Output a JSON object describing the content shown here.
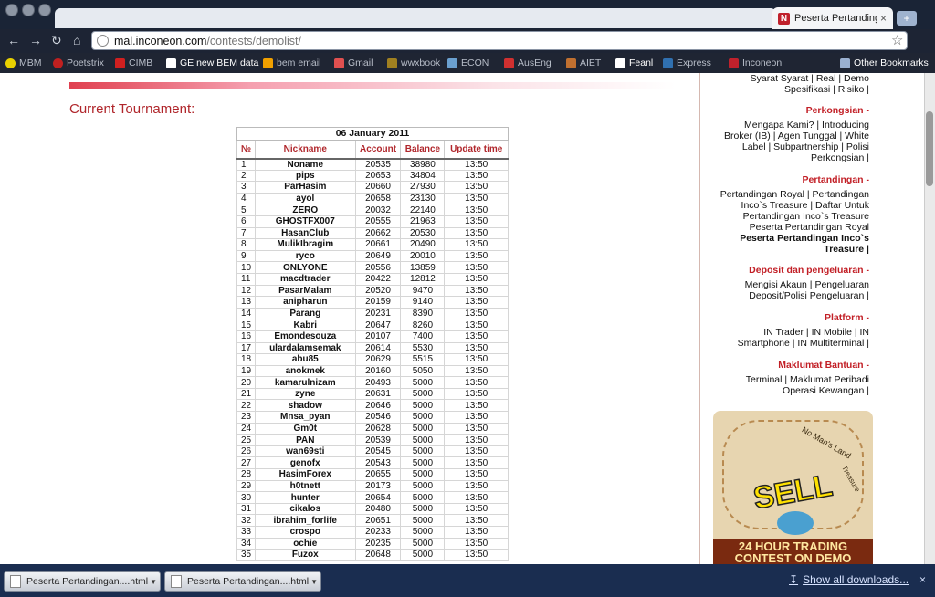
{
  "browser": {
    "tab_title": "Peserta Pertandingan",
    "tab_close": "×",
    "url_host": "mal.inconeon.com",
    "url_path": "/contests/demolist/",
    "bookmarks": [
      "MBM",
      "Poetstrix",
      "CIMB",
      "GE new BEM data",
      "bem email",
      "Gmail",
      "wwxbook",
      "ECON",
      "AusEng",
      "AIET",
      "Feanl",
      "Express",
      "Inconeon"
    ],
    "other_bookmarks": "Other Bookmarks"
  },
  "main": {
    "section_title": "Current Tournament:",
    "table": {
      "date": "06 January 2011",
      "columns": [
        "№",
        "Nickname",
        "Account",
        "Balance",
        "Update time"
      ],
      "rows": [
        [
          "1",
          "Noname",
          "20535",
          "38980",
          "13:50"
        ],
        [
          "2",
          "pips",
          "20653",
          "34804",
          "13:50"
        ],
        [
          "3",
          "ParHasim",
          "20660",
          "27930",
          "13:50"
        ],
        [
          "4",
          "ayol",
          "20658",
          "23130",
          "13:50"
        ],
        [
          "5",
          "ZERO",
          "20032",
          "22140",
          "13:50"
        ],
        [
          "6",
          "GHOSTFX007",
          "20555",
          "21963",
          "13:50"
        ],
        [
          "7",
          "HasanClub",
          "20662",
          "20530",
          "13:50"
        ],
        [
          "8",
          "MulikIbragim",
          "20661",
          "20490",
          "13:50"
        ],
        [
          "9",
          "ryco",
          "20649",
          "20010",
          "13:50"
        ],
        [
          "10",
          "ONLYONE",
          "20556",
          "13859",
          "13:50"
        ],
        [
          "11",
          "macdtrader",
          "20422",
          "12812",
          "13:50"
        ],
        [
          "12",
          "PasarMalam",
          "20520",
          "9470",
          "13:50"
        ],
        [
          "13",
          "anipharun",
          "20159",
          "9140",
          "13:50"
        ],
        [
          "14",
          "Parang",
          "20231",
          "8390",
          "13:50"
        ],
        [
          "15",
          "Kabri",
          "20647",
          "8260",
          "13:50"
        ],
        [
          "16",
          "Emondesouza",
          "20107",
          "7400",
          "13:50"
        ],
        [
          "17",
          "ulardalamsemak",
          "20614",
          "5530",
          "13:50"
        ],
        [
          "18",
          "abu85",
          "20629",
          "5515",
          "13:50"
        ],
        [
          "19",
          "anokmek",
          "20160",
          "5050",
          "13:50"
        ],
        [
          "20",
          "kamarulnizam",
          "20493",
          "5000",
          "13:50"
        ],
        [
          "21",
          "zyne",
          "20631",
          "5000",
          "13:50"
        ],
        [
          "22",
          "shadow",
          "20646",
          "5000",
          "13:50"
        ],
        [
          "23",
          "Mnsa_pyan",
          "20546",
          "5000",
          "13:50"
        ],
        [
          "24",
          "Gm0t",
          "20628",
          "5000",
          "13:50"
        ],
        [
          "25",
          "PAN",
          "20539",
          "5000",
          "13:50"
        ],
        [
          "26",
          "wan69sti",
          "20545",
          "5000",
          "13:50"
        ],
        [
          "27",
          "genofx",
          "20543",
          "5000",
          "13:50"
        ],
        [
          "28",
          "HasimForex",
          "20655",
          "5000",
          "13:50"
        ],
        [
          "29",
          "h0tnett",
          "20173",
          "5000",
          "13:50"
        ],
        [
          "30",
          "hunter",
          "20654",
          "5000",
          "13:50"
        ],
        [
          "31",
          "cikalos",
          "20480",
          "5000",
          "13:50"
        ],
        [
          "32",
          "ibrahim_forlife",
          "20651",
          "5000",
          "13:50"
        ],
        [
          "33",
          "crospo",
          "20233",
          "5000",
          "13:50"
        ],
        [
          "34",
          "ochie",
          "20235",
          "5000",
          "13:50"
        ],
        [
          "35",
          "Fuzox",
          "20648",
          "5000",
          "13:50"
        ]
      ]
    }
  },
  "sidebar": {
    "top_links": [
      "Syarat Syarat |  Real |  Demo",
      "Spesifikasi |  Risiko |"
    ],
    "sections": [
      {
        "title": "Perkongsian -",
        "lines": [
          "Mengapa Kami? |  Introducing",
          "Broker (IB) |  Agen Tunggal |  White",
          "Label |  Subpartnership |  Polisi",
          "Perkongsian |"
        ]
      },
      {
        "title": "Pertandingan -",
        "lines": [
          "Pertandingan Royal |  Pertandingan",
          "Inco`s Treasure |  Daftar Untuk",
          "Pertandingan Inco`s Treasure",
          "Peserta Pertandingan Royal",
          "Peserta Pertandingan Inco`s",
          "Treasure |"
        ]
      },
      {
        "title": "Deposit dan pengeluaran -",
        "lines": [
          "Mengisi Akaun |  Pengeluaran",
          "Deposit/Polisi Pengeluaran |"
        ]
      },
      {
        "title": "Platform -",
        "lines": [
          "IN Trader |  IN Mobile |  IN",
          "Smartphone |  IN Multiterminal |"
        ]
      },
      {
        "title": "Maklumat Bantuan -",
        "lines": [
          "Terminal |  Maklumat Peribadi",
          "Operasi Kewangan |"
        ]
      }
    ],
    "ad": {
      "headline": "SELL",
      "banner": "24 HOUR TRADING CONTEST ON DEMO",
      "map_text_1": "No Man's Land",
      "map_text_2": "Treasure"
    }
  },
  "downloads": {
    "items": [
      "Peserta Pertandingan....html",
      "Peserta Pertandingan....html"
    ],
    "show_all": "Show all downloads...",
    "close": "×"
  }
}
